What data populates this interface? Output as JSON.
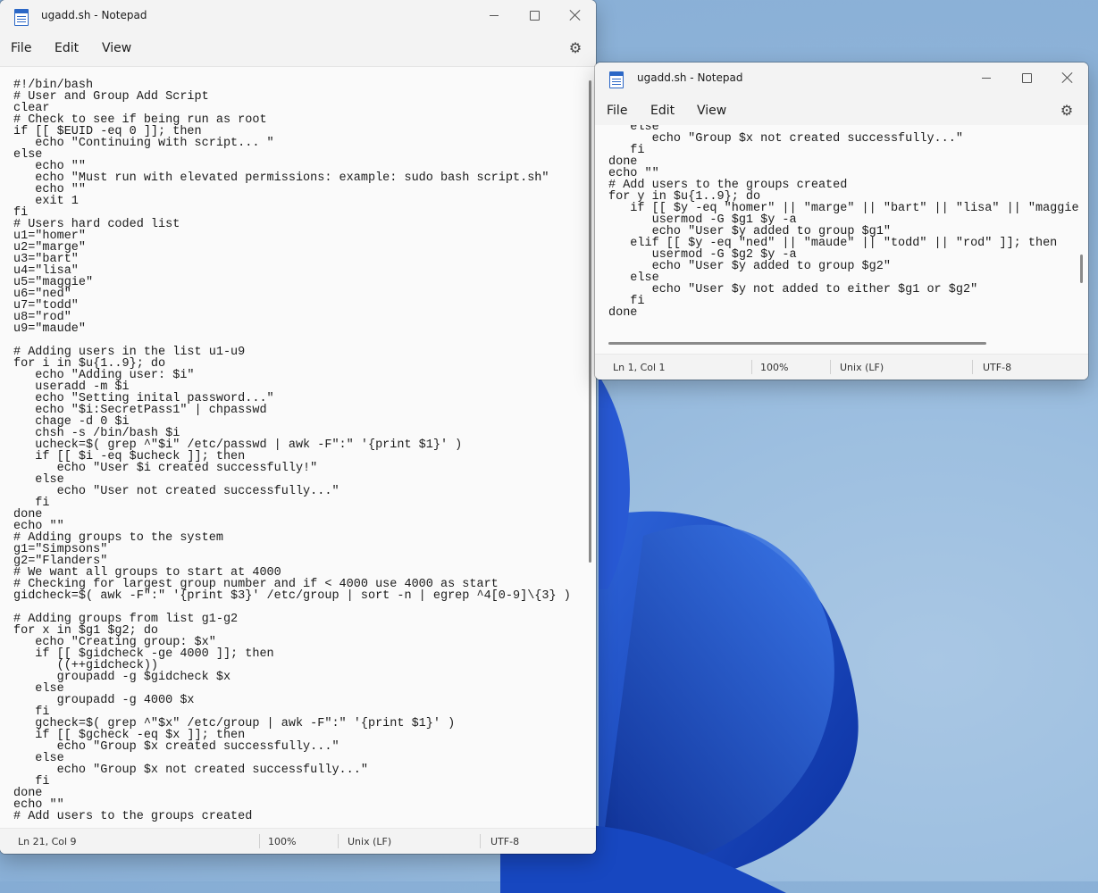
{
  "main_window": {
    "title": "ugadd.sh - Notepad",
    "menu": {
      "file": "File",
      "edit": "Edit",
      "view": "View"
    },
    "status": {
      "position": "Ln 21, Col 9",
      "zoom": "100%",
      "line_ending": "Unix (LF)",
      "encoding": "UTF-8"
    },
    "content": "#!/bin/bash\n# User and Group Add Script\nclear\n# Check to see if being run as root\nif [[ $EUID -eq 0 ]]; then\n   echo \"Continuing with script... \"\nelse\n   echo \"\"\n   echo \"Must run with elevated permissions: example: sudo bash script.sh\"\n   echo \"\"\n   exit 1\nfi\n# Users hard coded list\nu1=\"homer\"\nu2=\"marge\"\nu3=\"bart\"\nu4=\"lisa\"\nu5=\"maggie\"\nu6=\"ned\"\nu7=\"todd\"\nu8=\"rod\"\nu9=\"maude\"\n\n# Adding users in the list u1-u9\nfor i in $u{1..9}; do\n   echo \"Adding user: $i\"\n   useradd -m $i\n   echo \"Setting inital password...\"\n   echo \"$i:SecretPass1\" | chpasswd\n   chage -d 0 $i\n   chsh -s /bin/bash $i\n   ucheck=$( grep ^\"$i\" /etc/passwd | awk -F\":\" '{print $1}' )\n   if [[ $i -eq $ucheck ]]; then\n      echo \"User $i created successfully!\"\n   else\n      echo \"User not created successfully...\"\n   fi\ndone\necho \"\"\n# Adding groups to the system\ng1=\"Simpsons\"\ng2=\"Flanders\"\n# We want all groups to start at 4000\n# Checking for largest group number and if < 4000 use 4000 as start\ngidcheck=$( awk -F\":\" '{print $3}' /etc/group | sort -n | egrep ^4[0-9]\\{3} )\n\n# Adding groups from list g1-g2\nfor x in $g1 $g2; do\n   echo \"Creating group: $x\"\n   if [[ $gidcheck -ge 4000 ]]; then\n      ((++gidcheck))\n      groupadd -g $gidcheck $x\n   else\n      groupadd -g 4000 $x\n   fi\n   gcheck=$( grep ^\"$x\" /etc/group | awk -F\":\" '{print $1}' )\n   if [[ $gcheck -eq $x ]]; then\n      echo \"Group $x created successfully...\"\n   else\n      echo \"Group $x not created successfully...\"\n   fi\ndone\necho \"\"\n# Add users to the groups created"
  },
  "second_window": {
    "title": "ugadd.sh - Notepad",
    "menu": {
      "file": "File",
      "edit": "Edit",
      "view": "View"
    },
    "status": {
      "position": "Ln 1, Col 1",
      "zoom": "100%",
      "line_ending": "Unix (LF)",
      "encoding": "UTF-8"
    },
    "content": "   else\n      echo \"Group $x not created successfully...\"\n   fi\ndone\necho \"\"\n# Add users to the groups created\nfor y in $u{1..9}; do\n   if [[ $y -eq \"homer\" || \"marge\" || \"bart\" || \"lisa\" || \"maggie\n      usermod -G $g1 $y -a\n      echo \"User $y added to group $g1\"\n   elif [[ $y -eq \"ned\" || \"maude\" || \"todd\" || \"rod\" ]]; then\n      usermod -G $g2 $y -a\n      echo \"User $y added to group $g2\"\n   else\n      echo \"User $y not added to either $g1 or $g2\"\n   fi\ndone"
  }
}
